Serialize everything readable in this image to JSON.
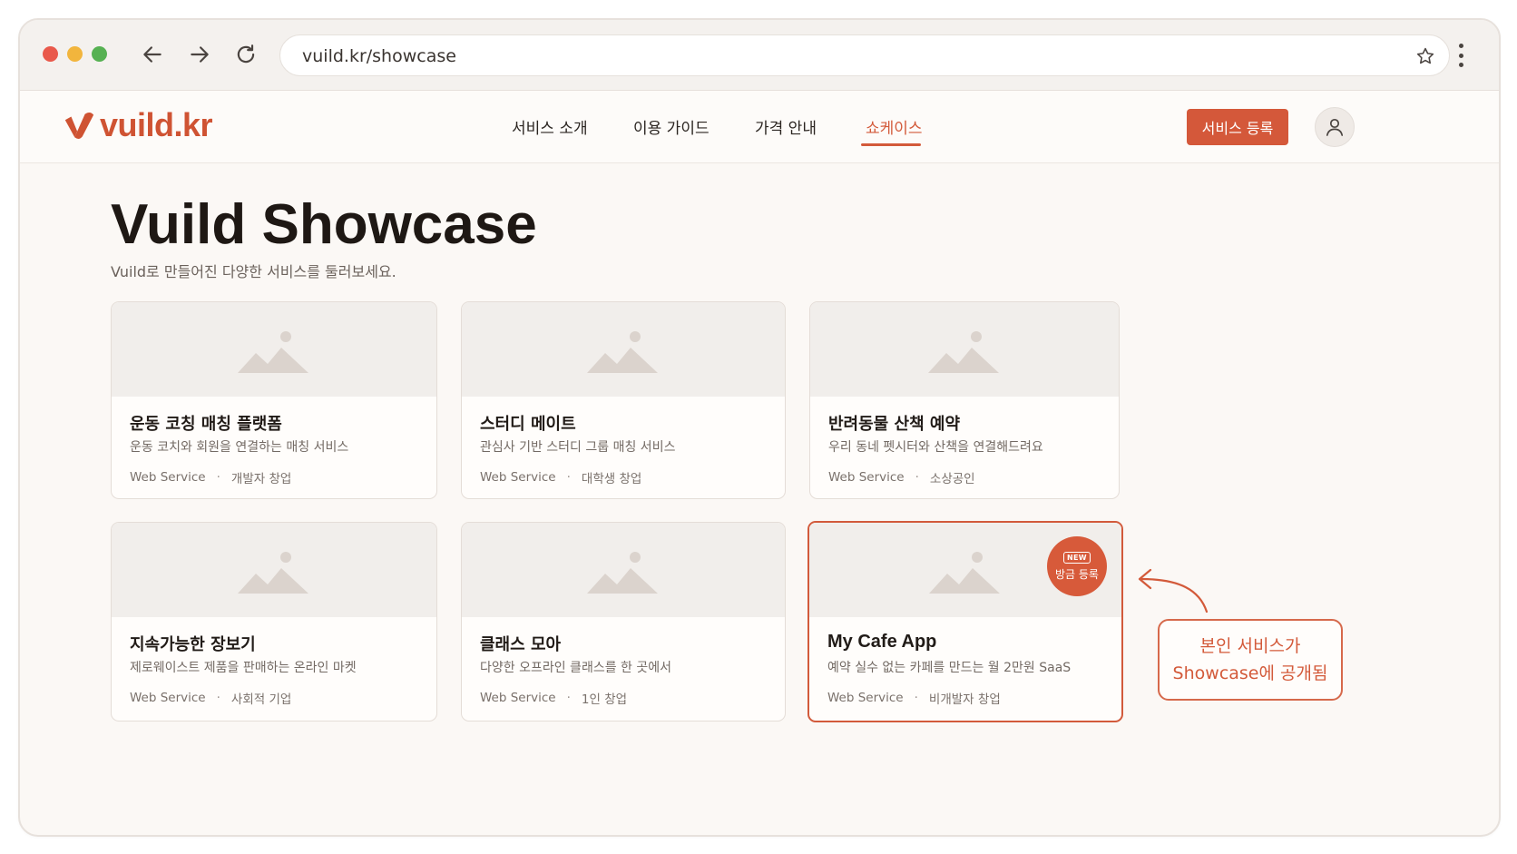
{
  "browser": {
    "url": "vuild.kr/showcase",
    "icons": {
      "back": "arrow-left-icon",
      "forward": "arrow-right-icon",
      "reload": "reload-icon",
      "bookmark": "star-icon",
      "menu": "kebab-menu-icon"
    }
  },
  "header": {
    "logo_text": "vuild.kr",
    "nav": [
      {
        "label": "서비스 소개"
      },
      {
        "label": "이용 가이드"
      },
      {
        "label": "가격 안내"
      },
      {
        "label": "쇼케이스",
        "active": true
      }
    ],
    "register_button": "서비스 등록",
    "avatar_icon": "user-icon"
  },
  "page": {
    "title": "Vuild Showcase",
    "subtitle": "Vuild로 만들어진 다양한 서비스를 둘러보세요."
  },
  "cards": [
    {
      "title": "운동 코칭 매칭 플랫폼",
      "description": "운동 코치와 회원을 연결하는 매칭 서비스",
      "type": "Web Service",
      "category": "개발자 창업"
    },
    {
      "title": "스터디 메이트",
      "description": "관심사 기반 스터디 그룹 매칭 서비스",
      "type": "Web Service",
      "category": "대학생 창업"
    },
    {
      "title": "반려동물 산책 예약",
      "description": "우리 동네 펫시터와 산책을 연결해드려요",
      "type": "Web Service",
      "category": "소상공인"
    },
    {
      "title": "지속가능한 장보기",
      "description": "제로웨이스트 제품을 판매하는 온라인 마켓",
      "type": "Web Service",
      "category": "사회적 기업"
    },
    {
      "title": "클래스 모아",
      "description": "다양한 오프라인 클래스를 한 곳에서",
      "type": "Web Service",
      "category": "1인 창업"
    },
    {
      "title": "My Cafe App",
      "description": "예약 실수 없는 카페를 만드는 월 2만원 SaaS",
      "type": "Web Service",
      "category": "비개발자 창업",
      "highlighted": true
    }
  ],
  "badge": {
    "tag": "NEW",
    "label": "방금 등록"
  },
  "callout": {
    "line1": "본인 서비스가",
    "line2": "Showcase에 공개됨"
  },
  "colors": {
    "accent": "#d4583a",
    "background": "#fbf8f5",
    "thumbnail": "#f1eeeb"
  }
}
